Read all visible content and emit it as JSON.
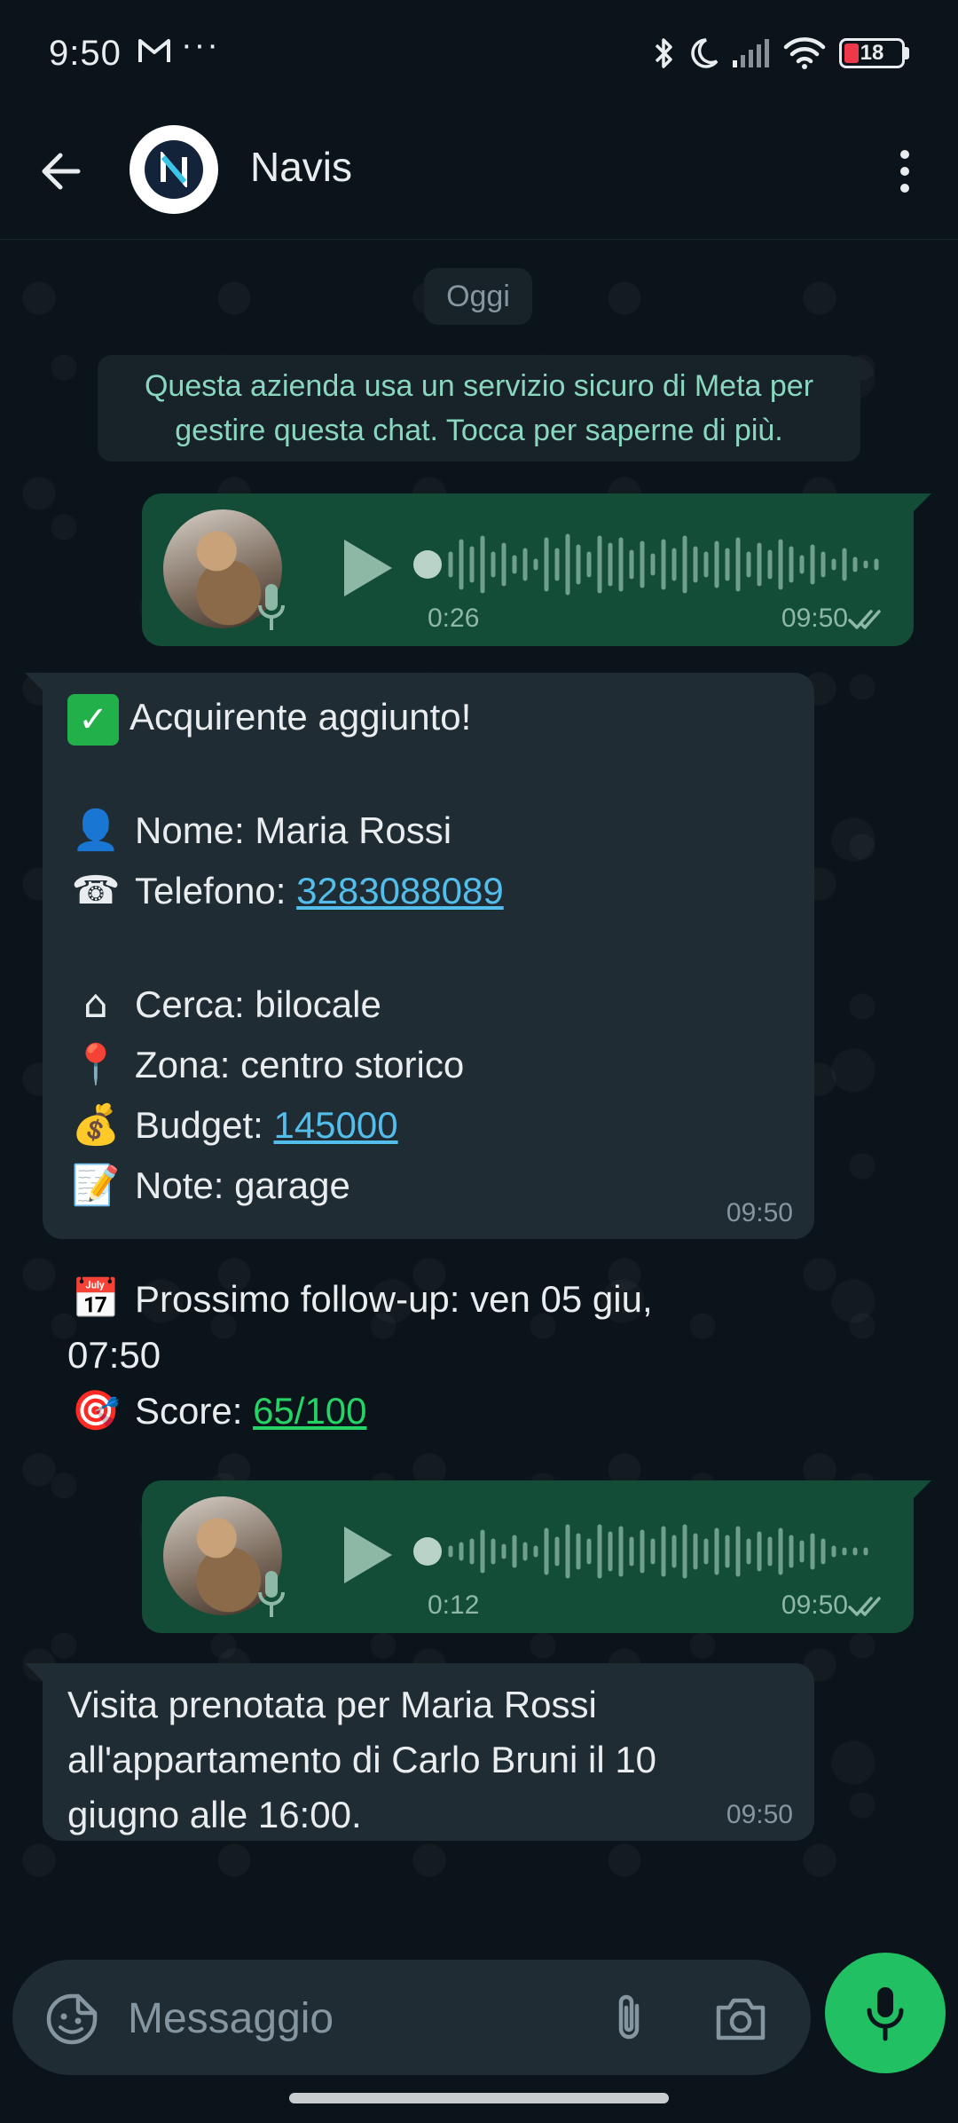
{
  "status": {
    "time": "9:50",
    "dots": "···",
    "battery": "18"
  },
  "header": {
    "contact_name": "Navis",
    "avatar_letter": "N"
  },
  "chat": {
    "date_label": "Oggi",
    "system_message": "Questa azienda usa un servizio sicuro di Meta per gestire questa chat. Tocca per saperne di più.",
    "voice1": {
      "duration": "0:26",
      "time": "09:50"
    },
    "card": {
      "title": "Acquirente aggiunto!",
      "name_label": "Nome:",
      "name_value": "Maria Rossi",
      "phone_label": "Telefono:",
      "phone_value": "3283088089",
      "search_label": "Cerca:",
      "search_value": "bilocale",
      "zone_label": "Zona:",
      "zone_value": "centro storico",
      "budget_label": "Budget:",
      "budget_value": "145000",
      "note_label": "Note:",
      "note_value": "garage",
      "followup_label": "Prossimo follow-up:",
      "followup_value": "ven 05 giu,",
      "followup_time": "07:50",
      "score_label": "Score:",
      "score_value": "65/100",
      "time": "09:50"
    },
    "voice2": {
      "duration": "0:12",
      "time": "09:50"
    },
    "visit_message": {
      "line1": "Visita prenotata per Maria Rossi",
      "line2": "all'appartamento di Carlo Bruni il 10",
      "line3": "giugno alle 16:00.",
      "time": "09:50"
    }
  },
  "composer": {
    "placeholder": "Messaggio"
  },
  "icons": {
    "back": "arrow-left-icon",
    "menu": "more-vertical-icon",
    "play": "play-icon",
    "sticker": "sticker-icon",
    "attach": "paperclip-icon",
    "camera": "camera-icon",
    "mic": "mic-icon"
  },
  "colors": {
    "background": "#0b141a",
    "outgoing_bubble": "#144d37",
    "incoming_bubble": "#202c33",
    "accent_green": "#21c063",
    "link_blue": "#53bdeb"
  }
}
